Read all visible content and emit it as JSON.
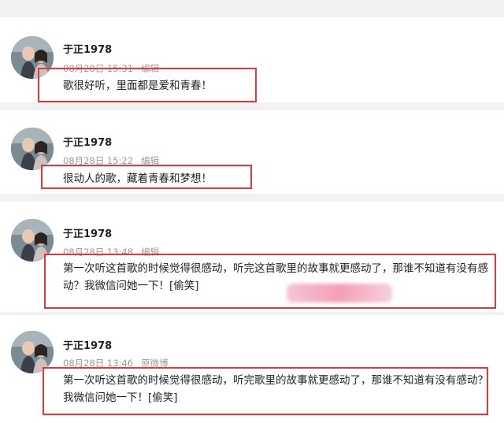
{
  "comments": [
    {
      "username": "于正1978",
      "time": "08月28日 15:31",
      "action": "编辑",
      "text": "歌很好听，里面都是爱和青春！"
    },
    {
      "username": "于正1978",
      "time": "08月28日 15:22",
      "action": "编辑",
      "text": "很动人的歌，藏着青春和梦想！"
    },
    {
      "username": "于正1978",
      "time": "08月28日 13:48",
      "action": "编辑",
      "text": "第一次听这首歌的时候觉得很感动，听完这首歌里的故事就更感动了，那谁不知道有没有感动？我微信问她一下！[偷笑]"
    },
    {
      "username": "于正1978",
      "time": "08月28日 13:46",
      "action": "原微博",
      "text": "第一次听这首歌的时候觉得很感动，听完歌里的故事就更感动了，那谁不知道有没有感动？我微信问她一下！[偷笑]"
    }
  ],
  "colors": {
    "highlight": "#e8353b",
    "meta_text": "#9b9b9b",
    "body_text": "#222222"
  }
}
